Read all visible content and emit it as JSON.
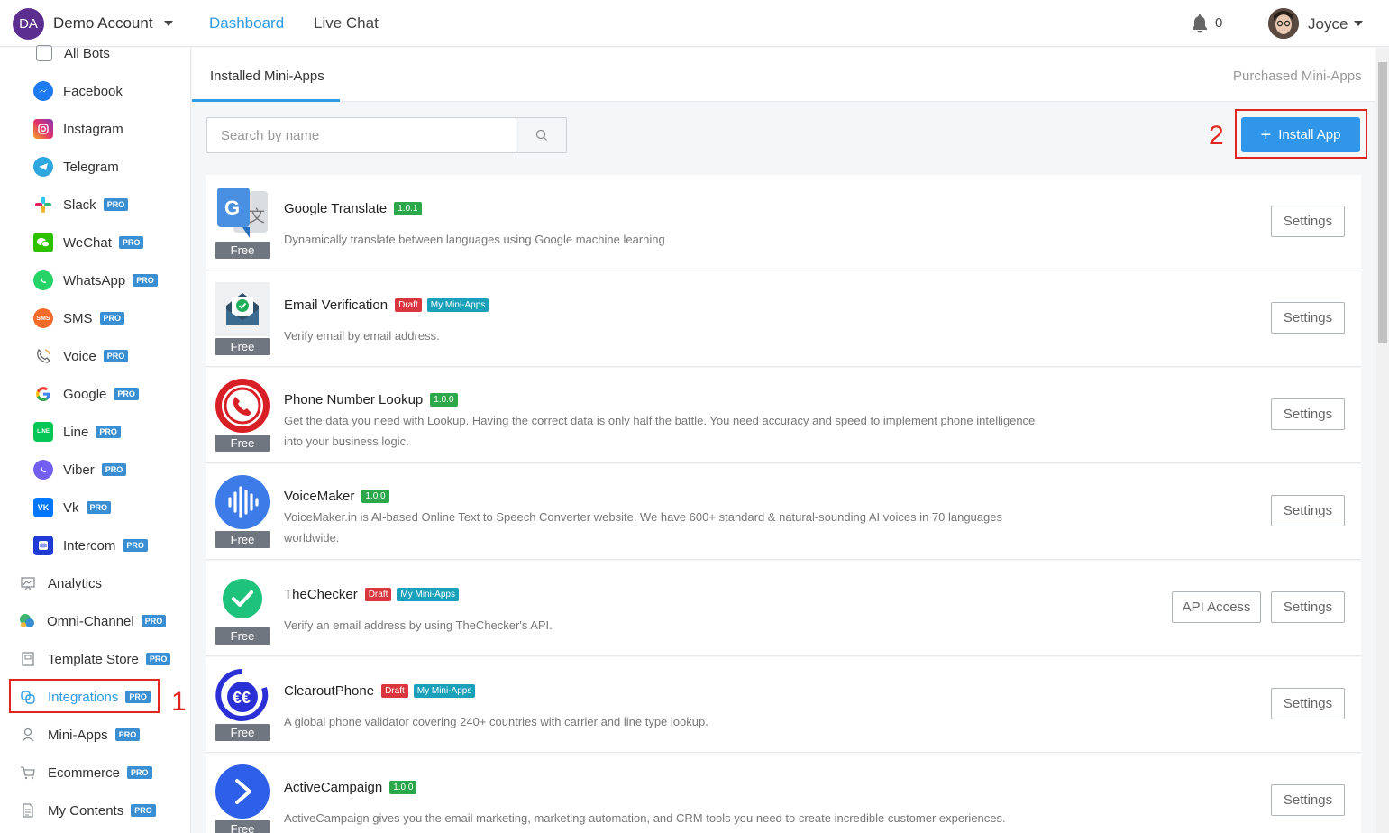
{
  "header": {
    "account_initials": "DA",
    "account_name": "Demo Account",
    "nav": [
      "Dashboard",
      "Live Chat"
    ],
    "notification_count": "0",
    "user_name": "Joyce"
  },
  "sidebar": {
    "items": [
      {
        "label": "All Bots",
        "pro": ""
      },
      {
        "label": "Facebook",
        "pro": ""
      },
      {
        "label": "Instagram",
        "pro": ""
      },
      {
        "label": "Telegram",
        "pro": ""
      },
      {
        "label": "Slack",
        "pro": "PRO"
      },
      {
        "label": "WeChat",
        "pro": "PRO"
      },
      {
        "label": "WhatsApp",
        "pro": "PRO"
      },
      {
        "label": "SMS",
        "pro": "PRO"
      },
      {
        "label": "Voice",
        "pro": "PRO"
      },
      {
        "label": "Google",
        "pro": "PRO"
      },
      {
        "label": "Line",
        "pro": "PRO"
      },
      {
        "label": "Viber",
        "pro": "PRO"
      },
      {
        "label": "Vk",
        "pro": "PRO"
      },
      {
        "label": "Intercom",
        "pro": "PRO"
      },
      {
        "label": "Analytics",
        "pro": ""
      },
      {
        "label": "Omni-Channel",
        "pro": "PRO"
      },
      {
        "label": "Template Store",
        "pro": "PRO"
      },
      {
        "label": "Integrations",
        "pro": "PRO"
      },
      {
        "label": "Mini-Apps",
        "pro": "PRO"
      },
      {
        "label": "Ecommerce",
        "pro": "PRO"
      },
      {
        "label": "My Contents",
        "pro": "PRO"
      }
    ]
  },
  "annotations": {
    "step1": "1",
    "step2": "2"
  },
  "tabs": {
    "installed": "Installed Mini-Apps",
    "purchased": "Purchased Mini-Apps"
  },
  "search": {
    "placeholder": "Search by name"
  },
  "install_button": "Install App",
  "free_label": "Free",
  "settings_label": "Settings",
  "api_access_label": "API Access",
  "apps": [
    {
      "name": "Google Translate",
      "tags": [
        {
          "type": "ver",
          "text": "1.0.1"
        }
      ],
      "desc": "Dynamically translate between languages using Google machine learning",
      "api": false
    },
    {
      "name": "Email Verification",
      "tags": [
        {
          "type": "draft",
          "text": "Draft"
        },
        {
          "type": "mine",
          "text": "My Mini-Apps"
        }
      ],
      "desc": "Verify email by email address.",
      "api": false
    },
    {
      "name": "Phone Number Lookup",
      "tags": [
        {
          "type": "ver",
          "text": "1.0.0"
        }
      ],
      "desc": "Get the data you need with Lookup. Having the correct data is only half the battle. You need accuracy and speed to implement phone intelligence into your business logic.",
      "api": false
    },
    {
      "name": "VoiceMaker",
      "tags": [
        {
          "type": "ver",
          "text": "1.0.0"
        }
      ],
      "desc": "VoiceMaker.in is AI-based Online Text to Speech Converter website. We have 600+ standard & natural-sounding AI voices in 70 languages worldwide.",
      "api": false
    },
    {
      "name": "TheChecker",
      "tags": [
        {
          "type": "draft",
          "text": "Draft"
        },
        {
          "type": "mine",
          "text": "My Mini-Apps"
        }
      ],
      "desc": "Verify an email address by using TheChecker's API.",
      "api": true
    },
    {
      "name": "ClearoutPhone",
      "tags": [
        {
          "type": "draft",
          "text": "Draft"
        },
        {
          "type": "mine",
          "text": "My Mini-Apps"
        }
      ],
      "desc": "A global phone validator covering 240+ countries with carrier and line type lookup.",
      "api": false
    },
    {
      "name": "ActiveCampaign",
      "tags": [
        {
          "type": "ver",
          "text": "1.0.0"
        }
      ],
      "desc": "ActiveCampaign gives you the email marketing, marketing automation, and CRM tools you need to create incredible customer experiences.",
      "api": false
    }
  ]
}
